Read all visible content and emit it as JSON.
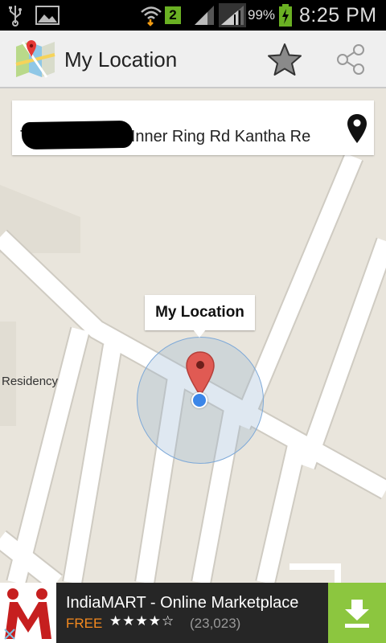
{
  "status_bar": {
    "sim_badge": "2",
    "battery_percent": "99%",
    "time": "8:25 PM",
    "icons": [
      "usb-icon",
      "gallery-icon",
      "wifi-icon",
      "signal-icon",
      "battery-charging-icon"
    ]
  },
  "action_bar": {
    "title": "My Location",
    "icons": [
      "maps-app-icon",
      "star-icon",
      "share-icon"
    ]
  },
  "address_card": {
    "address_visible": "T       Inner Ring Rd Kantha Re",
    "pin_icon": "place-pin-icon"
  },
  "map": {
    "location_label": "My Location",
    "poi_labels": [
      "Residency"
    ]
  },
  "ad": {
    "title": "IndiaMART - Online Marketplace",
    "price": "FREE",
    "stars": "★★★★☆",
    "rating_stars": 4,
    "reviews": "(23,023)",
    "colors": {
      "price": "#f58a1f",
      "download": "#8cc63f"
    }
  }
}
